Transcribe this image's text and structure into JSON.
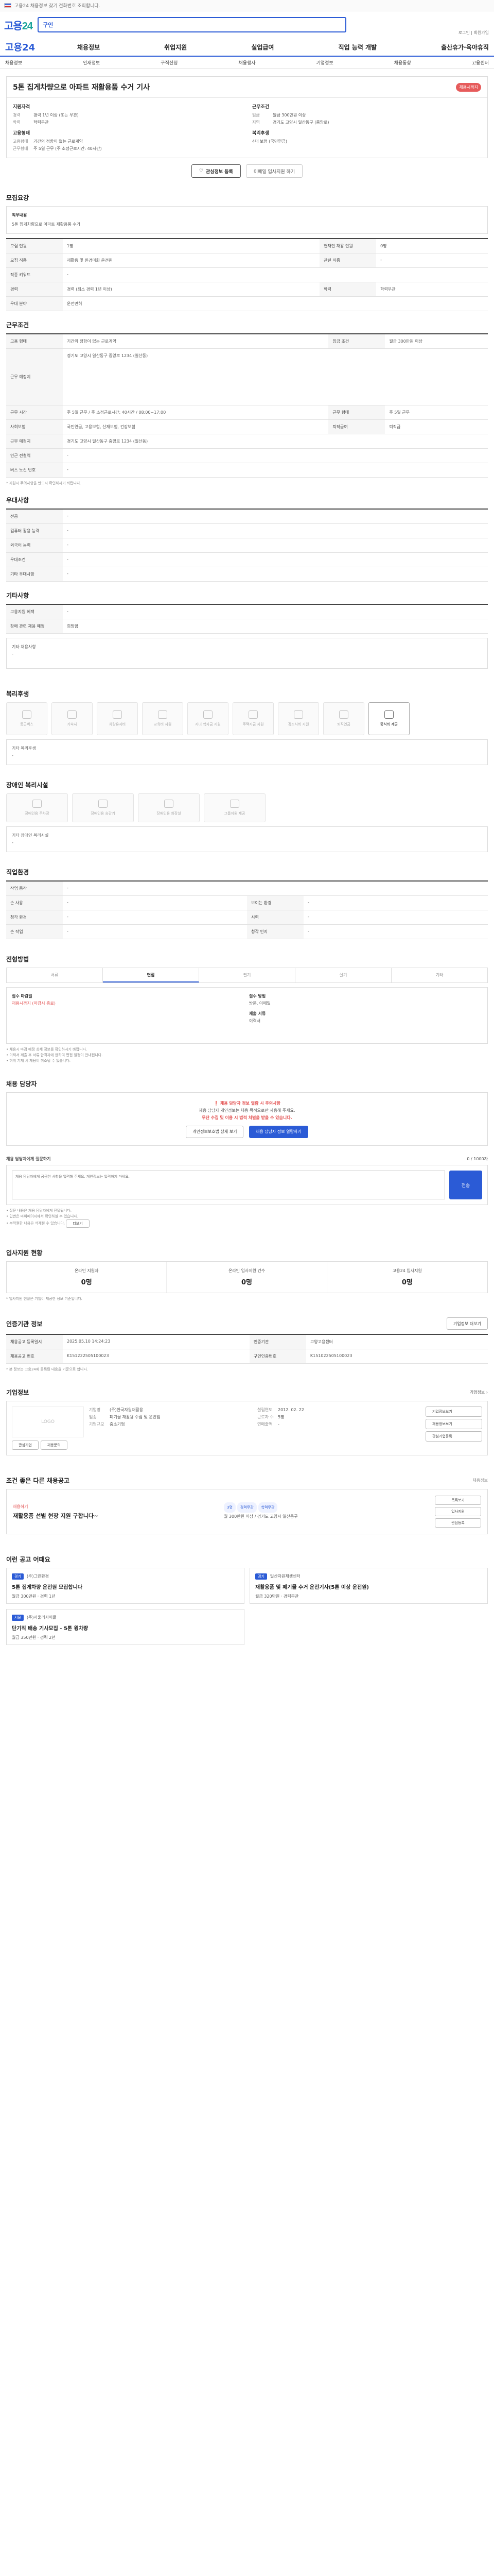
{
  "topbar": {
    "text": "고용24 채용정보 찾기 전화번호 조회합니다."
  },
  "search": {
    "brand_a": "고용",
    "brand_b": "24",
    "category": "구인",
    "placeholder": "",
    "toplinks": "로그인 | 회원가입"
  },
  "gnb": {
    "brand": "고용24",
    "menu": [
      "채용정보",
      "취업지원",
      "실업급여",
      "직업 능력 개발",
      "출산휴가·육아휴직"
    ]
  },
  "subnav": [
    "채용정보",
    "인재정보",
    "구직신청",
    "채용행사",
    "기업정보",
    "채용동향",
    "고용센터"
  ],
  "job": {
    "title": "5톤 집게차량으로 아파트 재활용품 수거 기사",
    "badge": "채용시까지",
    "left_group": "지원자격",
    "left_items": [
      {
        "k": "경력",
        "v": "경력 1년 이상 (또는 무관)"
      },
      {
        "k": "학력",
        "v": "학력무관"
      }
    ],
    "left_group2": "고용형태",
    "left_items2": [
      {
        "k": "고용형태",
        "v": "기간의 정함이 없는 근로계약"
      },
      {
        "k": "근무형태",
        "v": "주 5일 근무 (주 소정근로시간: 40시간)"
      }
    ],
    "right_group": "근무조건",
    "right_items": [
      {
        "k": "임금",
        "v": "월급 300만원 이상"
      },
      {
        "k": "지역",
        "v": "경기도 고양시 일산동구 (중앙로)"
      }
    ],
    "right_group2": "복리후생",
    "right_items2": [
      {
        "k": "",
        "v": "4대 보험 (국민연금)"
      }
    ],
    "btn_apply": "관심정보 등록",
    "btn_alert": "이메일 입사지원 하기"
  },
  "recruit": {
    "title": "모집요강",
    "box_title": "직무내용",
    "box_text": "5톤 집게차량으로 아파트 재활용품 수거"
  },
  "recruit_table": [
    [
      "모집 인원",
      "1명",
      "현재인 채용 인원",
      "0명"
    ],
    [
      "모집 직종",
      "재활용 및 환경미화 운전원",
      "관련 직종",
      "-"
    ],
    [
      "직종 키워드",
      "-",
      "",
      ""
    ],
    [
      "경력",
      "경력 (최소 경력 1년 이상)",
      "학력",
      "학력무관"
    ],
    [
      "우대 분야",
      "운전면허",
      "",
      ""
    ]
  ],
  "work": {
    "title": "근무조건"
  },
  "work_table": [
    [
      "고용 형태",
      "기간의 정함이 없는 근로계약",
      "임금 조건",
      "월급 300만원 이상"
    ],
    [
      "근무 예정지",
      "경기도 고양시 일산동구 중앙로 1234 (일산동)",
      "",
      ""
    ],
    [
      "근무 시간",
      "주 5일 근무 / 주 소정근로시간: 40시간 / 08:00~17:00",
      "근무 형태",
      "주 5일 근무"
    ],
    [
      "사회보험",
      "국민연금, 고용보험, 산재보험, 건강보험",
      "퇴직급여",
      "퇴직금"
    ],
    [
      "근무 예정지",
      "경기도 고양시 일산동구 중앙로 1234 (일산동)",
      "",
      ""
    ],
    [
      "인근 전철역",
      "-",
      "",
      ""
    ],
    [
      "버스 노선 번호",
      "-",
      "",
      ""
    ]
  ],
  "work_note": "* 지원시 주의사항을 반드시 확인하시기 바랍니다.",
  "pref": {
    "title": "우대사항",
    "rows": [
      [
        "전공",
        "-"
      ],
      [
        "컴퓨터 활용 능력",
        "-"
      ],
      [
        "외국어 능력",
        "-"
      ],
      [
        "우대조건",
        "-"
      ],
      [
        "기타 우대사항",
        "-"
      ]
    ]
  },
  "etc": {
    "title": "기타사항",
    "rows": [
      [
        "고용지원 혜택",
        "-"
      ],
      [
        "장애 관련 채용 예정",
        "희망함"
      ]
    ],
    "box_title": "기타 채용사항",
    "box_text": "-"
  },
  "welfare": {
    "title": "복리후생",
    "tiles": [
      "통근버스",
      "기숙사",
      "차량유지비",
      "교육비 지원",
      "자녀 학자금 지원",
      "주택자금 지원",
      "경조사비 지원",
      "퇴직연금",
      "중식비 제공"
    ],
    "active": "중식비 제공",
    "box_title": "기타 복리후생",
    "box_text": "-"
  },
  "disability": {
    "title": "장애인 복리시설",
    "tiles": [
      "장애인용 주차장",
      "장애인용 승강기",
      "장애인용 화장실",
      "그룹지원 제공"
    ],
    "box_title": "기타 장애인 복리시설",
    "box_text": "-"
  },
  "conditions": {
    "title": "직업환경",
    "rows": [
      [
        "작업 동작",
        "-",
        "",
        ""
      ],
      [
        "손 사용",
        "-",
        "보이는 환경",
        "-"
      ],
      [
        "청각 환경",
        "-",
        "시력",
        "-"
      ],
      [
        "손 작업",
        "-",
        "청각 인지",
        "-"
      ]
    ]
  },
  "method": {
    "title": "전형방법",
    "tabs": [
      "서류",
      "면접",
      "필기",
      "실기",
      "기타"
    ],
    "active_tab": "면접",
    "deadline_label": "접수 마감일",
    "deadline": "채용시까지 (마감시 종료)",
    "method_label": "접수 방법",
    "method_value": "방문, 이메일",
    "docs_label": "제출 서류",
    "docs_value": "이력서",
    "notes": [
      "• 채용시 마감 예정 상세 정보를 확인하시기 바랍니다.",
      "• 이력서 제출 후 서류 합격자에 한하여 면접 일정이 안내됩니다.",
      "• 허위 기재 시 채용이 취소될 수 있습니다."
    ]
  },
  "manager": {
    "title": "채용 담당자",
    "notice_title": "채용 담당자 정보 열람 시 주의사항",
    "notice_text": "채용 담당자 개인정보는 채용 목적으로만 사용해 주세요.",
    "notice_red": "무단 수집 및 이용 시 법적 처벌을 받을 수 있습니다.",
    "btn_a": "개인정보보호법 상세 보기",
    "btn_b": "채용 담당자 정보 열람하기"
  },
  "inquiry": {
    "title": "채용 담당자에게 질문하기",
    "hint": "0 / 1000자",
    "placeholder": "채용 담당자에게 궁금한 사항을 입력해 주세요. 개인정보는 입력하지 마세요.",
    "send": "전송",
    "notes": [
      "• 질문 내용은 채용 담당자에게 전달됩니다.",
      "• 답변은 마이페이지에서 확인하실 수 있습니다.",
      "• 부적절한 내용은 삭제될 수 있습니다."
    ],
    "more": "더보기"
  },
  "stats": {
    "title": "입사지원 현황",
    "items": [
      {
        "label": "온라인 지원자",
        "value": "0명"
      },
      {
        "label": "온라인 입사지원 건수",
        "value": "0명"
      },
      {
        "label": "고용24 입사지원",
        "value": "0명"
      }
    ],
    "note": "* 입사지원 현황은 기업이 제공한 정보 기준입니다."
  },
  "info": {
    "title": "인증기관 정보",
    "btn": "기업정보 더보기",
    "rows": [
      [
        "채용공고 등록일시",
        "2025.05.10 14:24:23",
        "인증기관",
        "고양고용센터"
      ],
      [
        "채용공고 번호",
        "K151222505100023",
        "구인인증번호",
        "K151022505100023"
      ]
    ],
    "note": "* 본 정보는 고용24에 등록된 내용을 기준으로 합니다."
  },
  "company": {
    "title": "기업정보",
    "more": "기업정보",
    "logo": "LOGO",
    "btn_a": "관심기업",
    "btn_b": "채용문의",
    "fields": [
      [
        "기업명",
        "(주)한국자원재활용"
      ],
      [
        "업종",
        "폐기물 재활용 수집 및 운반업"
      ],
      [
        "기업규모",
        "중소기업"
      ]
    ],
    "fields2": [
      [
        "설립연도",
        "2012. 02. 22"
      ],
      [
        "근로자 수",
        "5명"
      ],
      [
        "연매출액",
        "-"
      ]
    ],
    "side": [
      "기업정보보기",
      "채용정보보기",
      "관심기업등록"
    ]
  },
  "similar": {
    "title": "조건 좋은 다른 채용공고",
    "sub": "채용정보",
    "label": "채용하기",
    "heading": "재활용품 선별 현장 지원 구합니다~",
    "pills": [
      "3명",
      "경력무관",
      "학력무관"
    ],
    "info": "월 300만원 이상 / 경기도 고양시 일산동구",
    "btns": [
      "목록보기",
      "입사지원",
      "관심등록"
    ]
  },
  "others": {
    "title": "이런 공고 어때요",
    "cards": [
      {
        "tag": "경기",
        "company": "(주)그린환경",
        "title": "5톤 집게차량 운전원 모집합니다",
        "meta": "월급 300만원 · 경력 1년"
      },
      {
        "tag": "경기",
        "company": "일산자원재생센터",
        "title": "재활용품 및 폐기물 수거 운전기사(5톤 이상 운전원)",
        "meta": "월급 320만원 · 경력무관"
      },
      {
        "tag": "서울",
        "company": "(주)서울리사이클",
        "title": "단기직 배송 기사모집 - 5톤 윙차량",
        "meta": "월급 350만원 · 경력 2년"
      }
    ]
  }
}
